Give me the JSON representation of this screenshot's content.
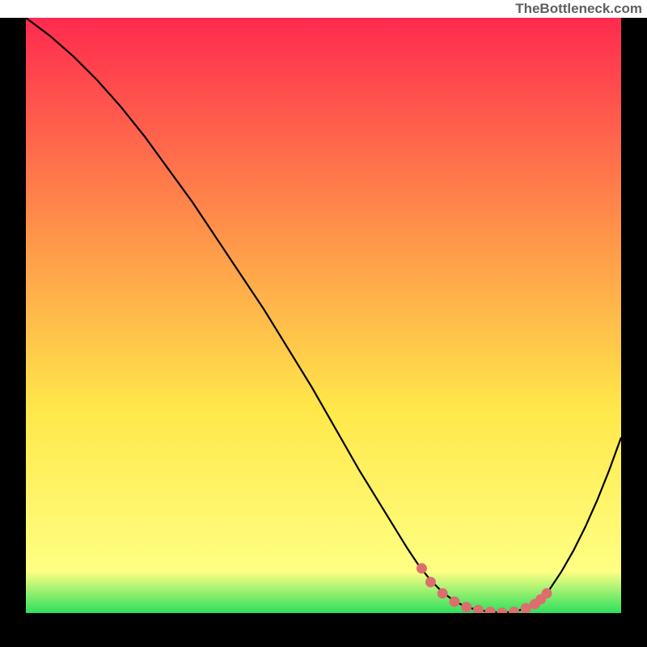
{
  "attribution": "TheBottleneck.com",
  "colors": {
    "frame": "#000000",
    "curve": "#000000",
    "markers": "#DC6E6E",
    "gradient_top": "#FF2A4F",
    "gradient_mid_high": "#FF8A4A",
    "gradient_mid_low": "#FFE84A",
    "gradient_low": "#FFFF83",
    "gradient_bottom": "#2DE05C"
  },
  "chart_data": {
    "type": "line",
    "title": "",
    "xlabel": "",
    "ylabel": "",
    "xlim": [
      0,
      100
    ],
    "ylim": [
      0,
      100
    ],
    "curve": {
      "x": [
        0,
        4,
        8,
        12,
        16,
        20,
        24,
        28,
        32,
        36,
        40,
        44,
        48,
        52,
        56,
        60,
        64,
        66,
        68,
        70,
        72,
        74,
        76,
        78,
        80,
        82,
        84,
        86,
        88,
        90,
        92,
        94,
        96,
        98,
        100
      ],
      "y": [
        100,
        97,
        93.5,
        89.5,
        85,
        80,
        74.5,
        69,
        63,
        57,
        51,
        44.5,
        38,
        31,
        24,
        17.5,
        11,
        8,
        5.5,
        3.5,
        2.0,
        1.0,
        0.5,
        0.2,
        0.05,
        0.2,
        0.8,
        2.0,
        4.0,
        7.0,
        10.5,
        14.5,
        19.0,
        24.0,
        29.5
      ]
    },
    "markers": {
      "x": [
        66.5,
        68,
        70,
        72,
        74,
        76,
        78,
        80,
        82,
        84,
        85.5,
        86.5,
        87.5
      ],
      "y": [
        7.5,
        5.2,
        3.3,
        1.9,
        1.0,
        0.5,
        0.2,
        0.05,
        0.2,
        0.8,
        1.5,
        2.3,
        3.3
      ]
    }
  }
}
